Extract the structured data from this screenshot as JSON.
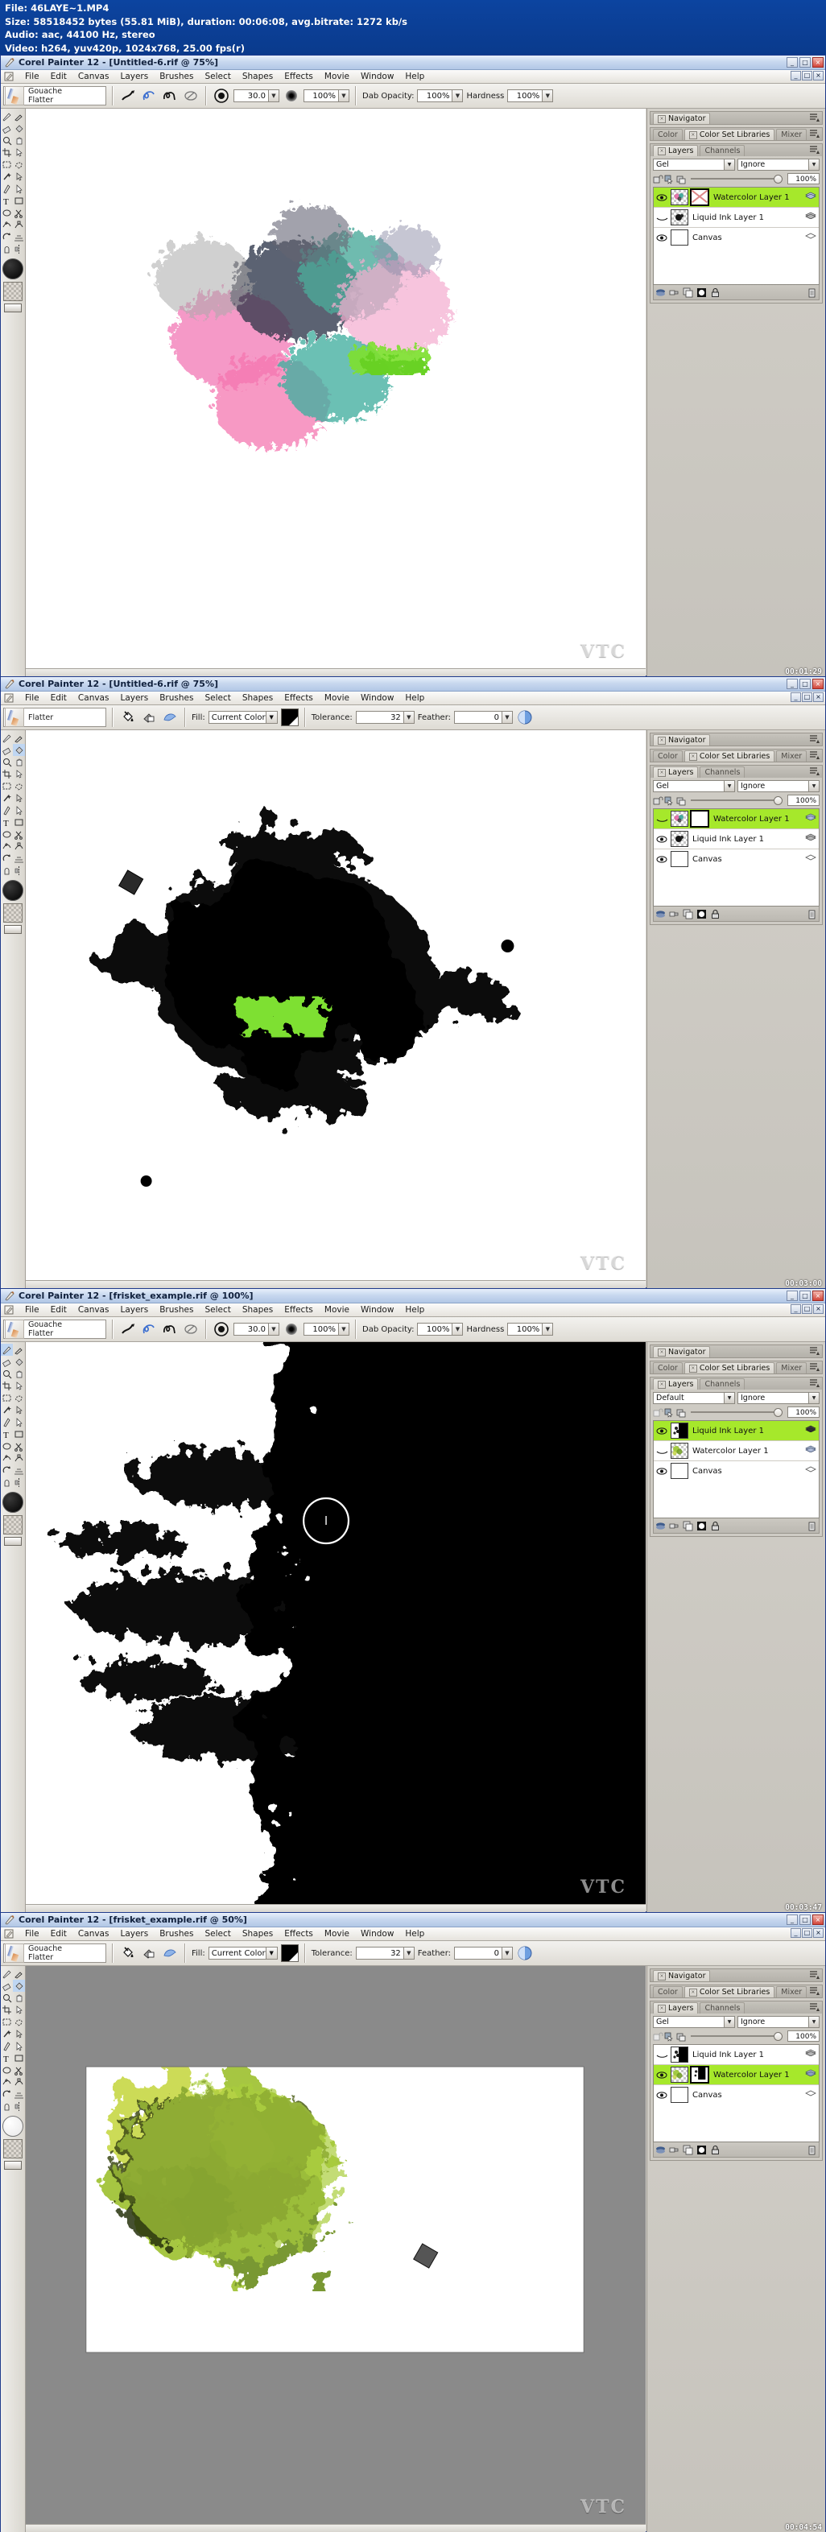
{
  "media_info": {
    "file": "File: 46LAYE~1.MP4",
    "size": "Size: 58518452 bytes (55.81 MiB), duration: 00:06:08, avg.bitrate: 1272 kb/s",
    "audio": "Audio: aac, 44100 Hz, stereo",
    "video": "Video: h264, yuv420p, 1024x768, 25.00 fps(r)"
  },
  "menu": [
    "File",
    "Edit",
    "Canvas",
    "Layers",
    "Brushes",
    "Select",
    "Shapes",
    "Effects",
    "Movie",
    "Window",
    "Help"
  ],
  "window_buttons": {
    "minimize": "_",
    "maximize": "□",
    "close": "×"
  },
  "palette_tabs": {
    "navigator": "Navigator",
    "color": "Color",
    "color_set_libraries": "Color Set Libraries",
    "mixer": "Mixer",
    "layers": "Layers",
    "channels": "Channels"
  },
  "windows": [
    {
      "id": "win1",
      "title": "Corel Painter 12 - [Untitled-6.rif @ 75%]",
      "tool": "brush",
      "brush": {
        "category": "Gouache",
        "variant": "Flatter"
      },
      "options": {
        "size_label": "",
        "size_value": "30.0",
        "opacity_value": "100%",
        "dab_opacity_label": "Dab Opacity:",
        "dab_opacity_value": "100%",
        "hardness_label": "Hardness",
        "hardness_value": "100%"
      },
      "layers_panel": {
        "composite_method": "Gel",
        "composite_depth": "Ignore",
        "opacity": "100%",
        "layers": [
          {
            "name": "Watercolor Layer 1",
            "selected": true,
            "visible": true,
            "thumb": "color-speckle",
            "mask_thumb": "crossed-out",
            "kind": "watercolor"
          },
          {
            "name": "Liquid Ink Layer 1",
            "selected": false,
            "visible": false,
            "thumb": "ink-speckle",
            "mask_thumb": "",
            "kind": "liquid-ink"
          },
          {
            "name": "Canvas",
            "selected": false,
            "visible": true,
            "thumb": "white",
            "mask_thumb": "",
            "kind": "canvas"
          }
        ]
      },
      "timestamp": "00:01:29",
      "watermark": "VTC"
    },
    {
      "id": "win2",
      "title": "Corel Painter 12 - [Untitled-6.rif @ 75%]",
      "tool": "paint-bucket",
      "brush": {
        "category": "",
        "variant": "Flatter"
      },
      "options": {
        "fill_label": "Fill:",
        "fill_value": "Current Color",
        "tolerance_label": "Tolerance:",
        "tolerance_value": "32",
        "feather_label": "Feather:",
        "feather_value": "0"
      },
      "layers_panel": {
        "composite_method": "Gel",
        "composite_depth": "Ignore",
        "opacity": "100%",
        "layers": [
          {
            "name": "Watercolor Layer 1",
            "selected": true,
            "visible": false,
            "thumb": "color-speckle",
            "mask_thumb": "white",
            "kind": "watercolor"
          },
          {
            "name": "Liquid Ink Layer 1",
            "selected": false,
            "visible": true,
            "thumb": "ink-speckle",
            "mask_thumb": "",
            "kind": "liquid-ink"
          },
          {
            "name": "Canvas",
            "selected": false,
            "visible": true,
            "thumb": "white",
            "mask_thumb": "",
            "kind": "canvas"
          }
        ]
      },
      "timestamp": "00:03:00",
      "watermark": "VTC"
    },
    {
      "id": "win3",
      "title": "Corel Painter 12 - [frisket_example.rif @ 100%]",
      "tool": "brush",
      "brush": {
        "category": "Gouache",
        "variant": "Flatter"
      },
      "options": {
        "size_value": "30.0",
        "opacity_value": "100%",
        "dab_opacity_label": "Dab Opacity:",
        "dab_opacity_value": "100%",
        "hardness_label": "Hardness",
        "hardness_value": "100%"
      },
      "layers_panel": {
        "composite_method": "Default",
        "composite_depth": "Ignore",
        "opacity": "100%",
        "layers": [
          {
            "name": "Liquid Ink Layer 1",
            "selected": true,
            "visible": true,
            "thumb": "ink-bw",
            "mask_thumb": "",
            "kind": "liquid-ink"
          },
          {
            "name": "Watercolor Layer 1",
            "selected": false,
            "visible": false,
            "thumb": "green-speckle",
            "mask_thumb": "",
            "kind": "watercolor"
          },
          {
            "name": "Canvas",
            "selected": false,
            "visible": true,
            "thumb": "white",
            "mask_thumb": "",
            "kind": "canvas"
          }
        ]
      },
      "timestamp": "00:03:47",
      "watermark": "VTC"
    },
    {
      "id": "win4",
      "title": "Corel Painter 12 - [frisket_example.rif @ 50%]",
      "tool": "paint-bucket",
      "brush": {
        "category": "Gouache",
        "variant": "Flatter"
      },
      "options": {
        "fill_label": "Fill:",
        "fill_value": "Current Color",
        "tolerance_label": "Tolerance:",
        "tolerance_value": "32",
        "feather_label": "Feather:",
        "feather_value": "0"
      },
      "layers_panel": {
        "composite_method": "Gel",
        "composite_depth": "Ignore",
        "opacity": "100%",
        "layers": [
          {
            "name": "Liquid Ink Layer 1",
            "selected": false,
            "visible": false,
            "thumb": "ink-bw",
            "mask_thumb": "",
            "kind": "liquid-ink"
          },
          {
            "name": "Watercolor Layer 1",
            "selected": true,
            "visible": true,
            "thumb": "green-speckle",
            "mask_thumb": "ink-bw",
            "kind": "watercolor"
          },
          {
            "name": "Canvas",
            "selected": false,
            "visible": true,
            "thumb": "white",
            "mask_thumb": "",
            "kind": "canvas"
          }
        ]
      },
      "timestamp": "00:04:54",
      "watermark": "VTC"
    }
  ],
  "colors": {
    "titlebar_blue": "#0b3d91",
    "selection_green": "#a6e82b",
    "panel_grey": "#cecbc4",
    "toolbar_grey": "#d6d3ce"
  }
}
